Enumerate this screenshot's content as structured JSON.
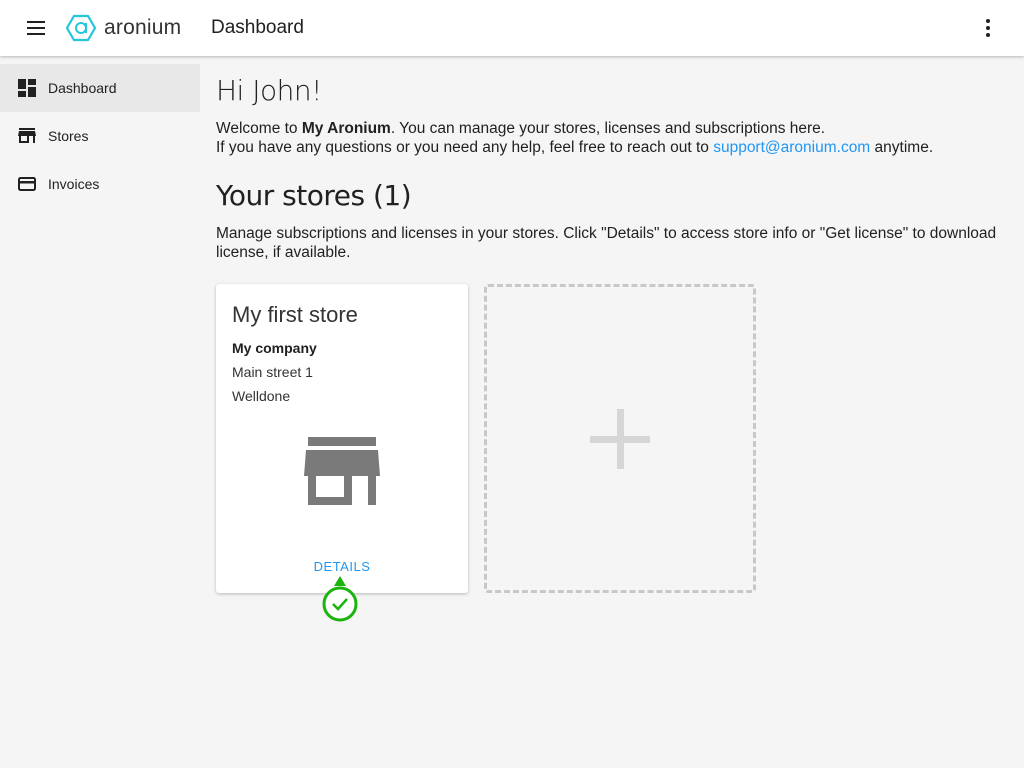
{
  "app": {
    "logo_text": "aronium",
    "page_title": "Dashboard"
  },
  "sidebar": {
    "items": [
      {
        "label": "Dashboard",
        "icon": "dashboard-icon",
        "active": true
      },
      {
        "label": "Stores",
        "icon": "store-icon"
      },
      {
        "label": "Invoices",
        "icon": "credit-card-icon"
      }
    ]
  },
  "main": {
    "greeting": "Hi John!",
    "welcome_prefix": "Welcome to ",
    "welcome_brand": "My Aronium",
    "welcome_suffix": ". You can manage your stores, licenses and subscriptions here.",
    "help_prefix": "If you have any questions or you need any help, feel free to reach out to ",
    "support_email": "support@aronium.com",
    "help_suffix": " anytime.",
    "stores_heading": "Your stores (1)",
    "stores_description": "Manage subscriptions and licenses in your stores. Click \"Details\" to access store info or \"Get license\" to download license, if available."
  },
  "stores": [
    {
      "name": "My first store",
      "company": "My company",
      "address": "Main street 1",
      "city": "Welldone",
      "details_label": "DETAILS"
    }
  ],
  "colors": {
    "accent": "#2196f3",
    "logo": "#26c6da",
    "marker": "#1db30f"
  }
}
